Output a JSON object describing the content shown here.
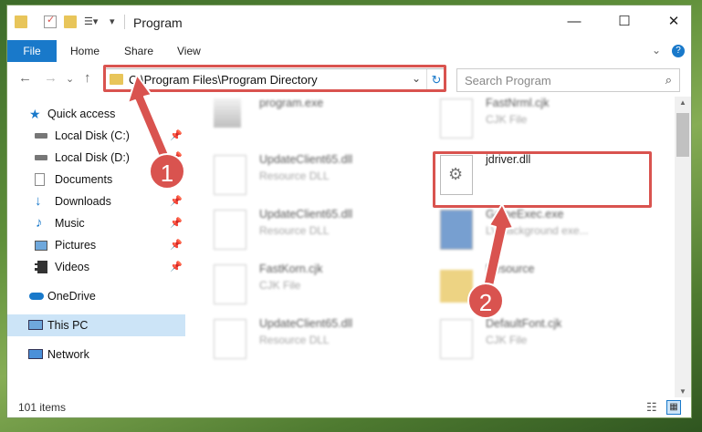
{
  "window": {
    "title": "Program"
  },
  "ribbon": {
    "tabs": [
      "File",
      "Home",
      "Share",
      "View"
    ]
  },
  "address": {
    "path": "C:\\Program Files\\Program Directory"
  },
  "search": {
    "placeholder": "Search Program"
  },
  "sidebar": {
    "items": [
      {
        "label": "Quick access"
      },
      {
        "label": "Local Disk (C:)"
      },
      {
        "label": "Local Disk (D:)"
      },
      {
        "label": "Documents"
      },
      {
        "label": "Downloads"
      },
      {
        "label": "Music"
      },
      {
        "label": "Pictures"
      },
      {
        "label": "Videos"
      },
      {
        "label": "OneDrive"
      },
      {
        "label": "This PC"
      },
      {
        "label": "Network"
      }
    ]
  },
  "files": [
    {
      "name": "program.exe",
      "type": ""
    },
    {
      "name": "FastNrml.cjk",
      "type": "CJK File"
    },
    {
      "name": "UpdateClient65.dll",
      "type": "Resource DLL"
    },
    {
      "name": "jdriver.dll",
      "type": ""
    },
    {
      "name": "UpdateClient65.dll",
      "type": "Resource DLL"
    },
    {
      "name": "GameExec.exe",
      "type": "LV background exe..."
    },
    {
      "name": "FastKorn.cjk",
      "type": "CJK File"
    },
    {
      "name": "Resource",
      "type": ""
    },
    {
      "name": "UpdateClient65.dll",
      "type": "Resource DLL"
    },
    {
      "name": "DefaultFont.cjk",
      "type": "CJK File"
    }
  ],
  "status": {
    "count": "101 items"
  },
  "callouts": {
    "one": "1",
    "two": "2"
  },
  "colors": {
    "accent": "#1979ca",
    "highlight": "#d9534f",
    "selected": "#cce4f7"
  }
}
